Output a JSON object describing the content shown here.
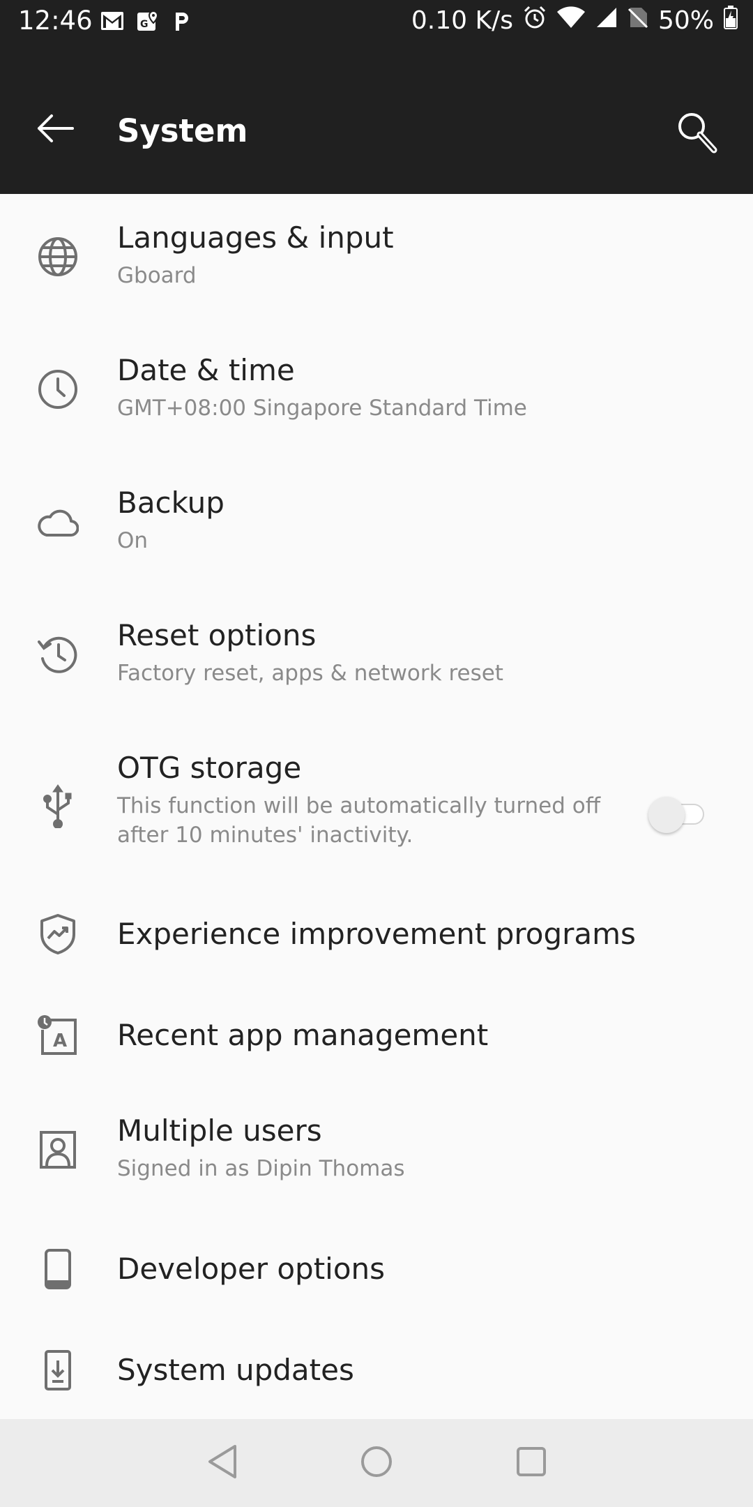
{
  "status_bar": {
    "time": "12:46",
    "net_speed": "0.10 K/s",
    "battery": "50%",
    "left_icons": [
      "gmail-icon",
      "google-maps-icon",
      "paytm-icon"
    ],
    "right_icons": [
      "alarm-icon",
      "wifi-icon",
      "cell-signal-icon",
      "no-sim-icon",
      "battery-icon"
    ]
  },
  "app_bar": {
    "title": "System"
  },
  "items": [
    {
      "title": "Languages & input",
      "subtitle": "Gboard",
      "icon": "globe-icon"
    },
    {
      "title": "Date & time",
      "subtitle": "GMT+08:00 Singapore Standard Time",
      "icon": "clock-icon"
    },
    {
      "title": "Backup",
      "subtitle": "On",
      "icon": "cloud-icon"
    },
    {
      "title": "Reset options",
      "subtitle": "Factory reset, apps & network reset",
      "icon": "history-icon"
    },
    {
      "title": "OTG storage",
      "subtitle_line1": "This function will be automatically turned off",
      "subtitle_line2": "after 10 minutes' inactivity.",
      "icon": "usb-icon",
      "toggle_on": false
    },
    {
      "title": "Experience improvement programs",
      "icon": "shield-chart-icon"
    },
    {
      "title": "Recent app management",
      "icon": "recent-app-icon"
    },
    {
      "title": "Multiple users",
      "subtitle": "Signed in as Dipin Thomas",
      "icon": "user-icon"
    },
    {
      "title": "Developer options",
      "icon": "phone-icon"
    },
    {
      "title": "System updates",
      "icon": "system-update-icon"
    }
  ],
  "nav_bar": {
    "buttons": [
      "back-triangle-icon",
      "home-circle-icon",
      "recents-square-icon"
    ]
  },
  "colors": {
    "app_bar_bg": "#202020",
    "list_bg": "#fafafa",
    "nav_bg": "#ececec",
    "icon_gray": "#6f6f6f"
  }
}
